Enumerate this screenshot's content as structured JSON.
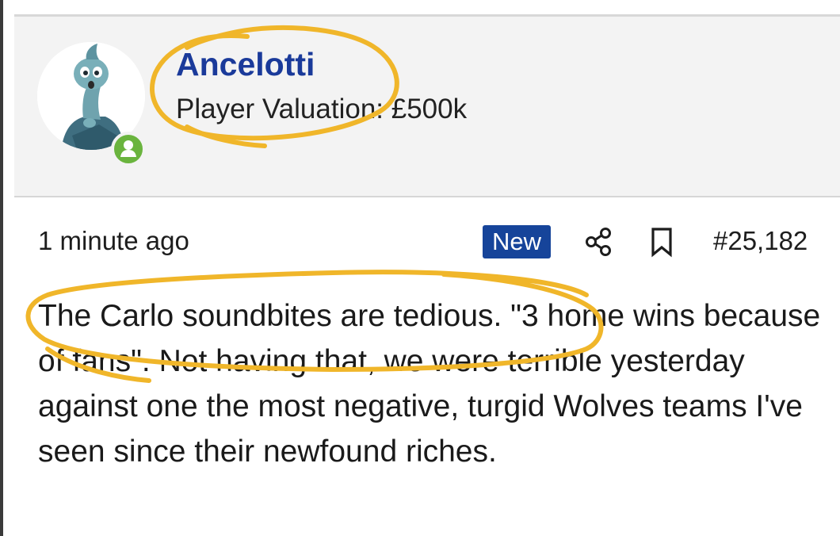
{
  "post": {
    "author": {
      "name": "Ancelotti",
      "valuation": "Player Valuation: £500k",
      "avatar_icon": "cartoon-dinosaur-avatar",
      "status_icon": "online-user-icon"
    },
    "meta": {
      "time": "1 minute ago",
      "new_badge": "New",
      "share_icon": "share-icon",
      "bookmark_icon": "bookmark-icon",
      "post_number": "#25,182"
    },
    "body": "The Carlo soundbites are tedious. \"3 home wins because of fans\". Not having that, we were terrible yesterday against one the most negative, turgid Wolves teams I've seen since their newfound riches."
  },
  "colors": {
    "username": "#1a3a9a",
    "badge_bg": "#16449a",
    "online": "#6ab43e",
    "highlight_scribble": "#f0b62a",
    "panel_bg": "#f3f3f3"
  }
}
